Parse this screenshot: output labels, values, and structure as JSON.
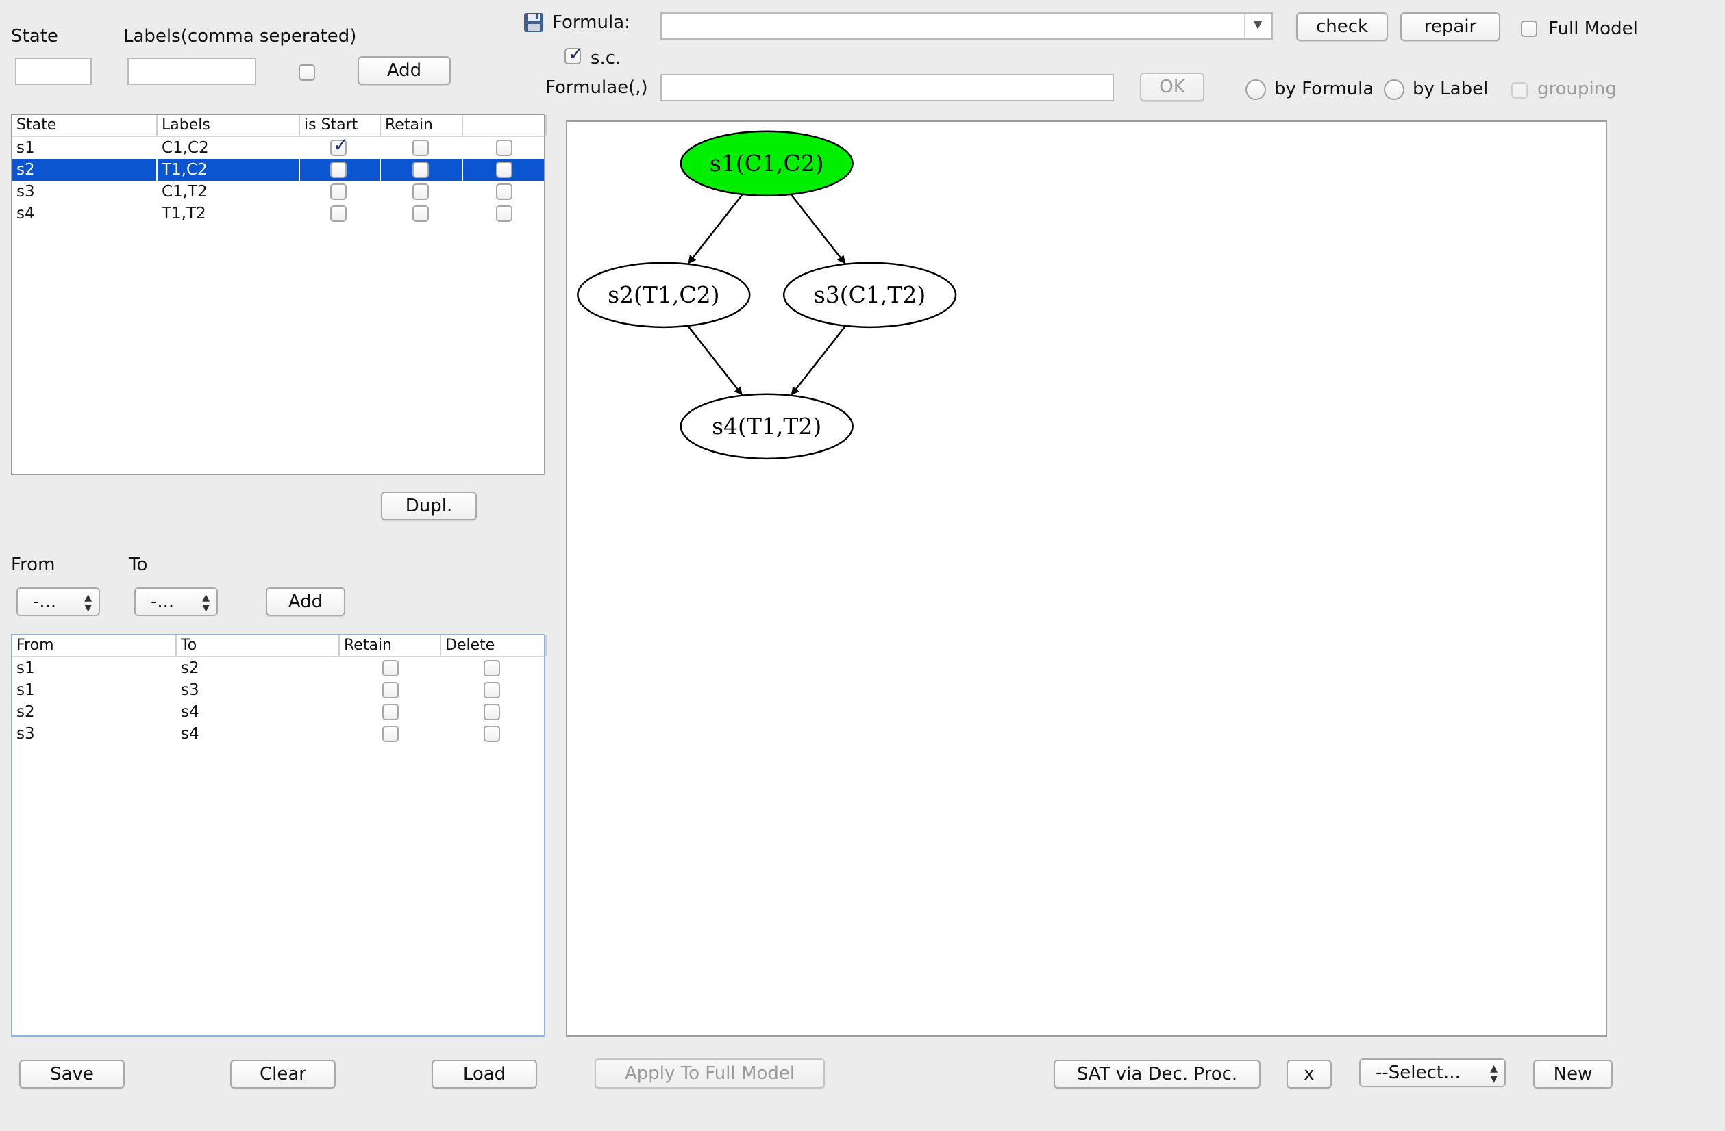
{
  "state_form": {
    "state_label": "State",
    "labels_label": "Labels(comma seperated)",
    "state_value": "",
    "labels_value": "",
    "add_label": "Add"
  },
  "states_table": {
    "headers": [
      "State",
      "Labels",
      "is Start",
      "Retain",
      ""
    ],
    "rows": [
      {
        "state": "s1",
        "labels": "C1,C2",
        "is_start": true,
        "retain": false,
        "extra": false,
        "selected": false
      },
      {
        "state": "s2",
        "labels": "T1,C2",
        "is_start": false,
        "retain": false,
        "extra": false,
        "selected": true
      },
      {
        "state": "s3",
        "labels": "C1,T2",
        "is_start": false,
        "retain": false,
        "extra": false,
        "selected": false
      },
      {
        "state": "s4",
        "labels": "T1,T2",
        "is_start": false,
        "retain": false,
        "extra": false,
        "selected": false
      }
    ]
  },
  "dupl_label": "Dupl.",
  "transition_form": {
    "from_label": "From",
    "to_label": "To",
    "from_value": "-...",
    "to_value": "-...",
    "add_label": "Add"
  },
  "transitions_table": {
    "headers": [
      "From",
      "To",
      "Retain",
      "Delete"
    ],
    "rows": [
      {
        "from": "s1",
        "to": "s2"
      },
      {
        "from": "s1",
        "to": "s3"
      },
      {
        "from": "s2",
        "to": "s4"
      },
      {
        "from": "s3",
        "to": "s4"
      }
    ]
  },
  "formula_bar": {
    "formula_label": "Formula:",
    "formula_value": "",
    "check_label": "check",
    "repair_label": "repair",
    "full_model_label": "Full Model",
    "sc_label": "s.c.",
    "formulae_label": "Formulae(,)",
    "formulae_value": "",
    "ok_label": "OK",
    "by_formula_label": "by Formula",
    "by_label_label": "by Label",
    "grouping_label": "grouping"
  },
  "graph": {
    "nodes": [
      {
        "id": "s1",
        "label": "s1(C1,C2)",
        "fill": "#00ee00"
      },
      {
        "id": "s2",
        "label": "s2(T1,C2)",
        "fill": "#ffffff"
      },
      {
        "id": "s3",
        "label": "s3(C1,T2)",
        "fill": "#ffffff"
      },
      {
        "id": "s4",
        "label": "s4(T1,T2)",
        "fill": "#ffffff"
      }
    ],
    "edges": [
      [
        "s1",
        "s2"
      ],
      [
        "s1",
        "s3"
      ],
      [
        "s2",
        "s4"
      ],
      [
        "s3",
        "s4"
      ]
    ]
  },
  "bottom_bar": {
    "save_label": "Save",
    "clear_label": "Clear",
    "load_label": "Load",
    "apply_label": "Apply To Full Model",
    "sat_label": "SAT via Dec. Proc.",
    "x_label": "x",
    "select_value": "--Select...",
    "new_label": "New"
  },
  "colors": {
    "selection": "#0b55d0",
    "start_node": "#00ee00"
  }
}
